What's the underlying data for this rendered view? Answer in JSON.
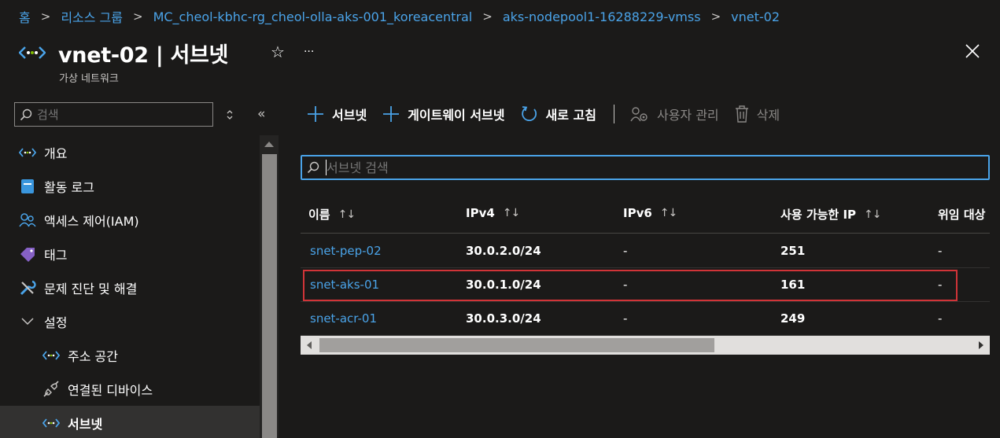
{
  "breadcrumb": [
    {
      "label": "홈"
    },
    {
      "label": "리소스 그룹"
    },
    {
      "label": "MC_cheol-kbhc-rg_cheol-olla-aks-001_koreacentral"
    },
    {
      "label": "aks-nodepool1-16288229-vmss"
    },
    {
      "label": "vnet-02"
    }
  ],
  "header": {
    "title": "vnet-02 | 서브넷",
    "subtitle": "가상 네트워크",
    "favorite_glyph": "☆",
    "more_glyph": "···"
  },
  "sidebar": {
    "search_placeholder": "검색",
    "collapse_glyph": "«",
    "items": [
      {
        "label": "개요",
        "icon": "vnet-icon"
      },
      {
        "label": "활동 로그",
        "icon": "activity-log-icon"
      },
      {
        "label": "액세스 제어(IAM)",
        "icon": "people-icon"
      },
      {
        "label": "태그",
        "icon": "tag-icon"
      },
      {
        "label": "문제 진단 및 해결",
        "icon": "wrench-icon"
      },
      {
        "label": "설정",
        "icon": "chevron-down-icon"
      },
      {
        "label": "주소 공간",
        "icon": "vnet-icon"
      },
      {
        "label": "연결된 디바이스",
        "icon": "plug-icon"
      },
      {
        "label": "서브넷",
        "icon": "vnet-icon"
      }
    ]
  },
  "toolbar": {
    "add_subnet": "서브넷",
    "add_gateway_subnet": "게이트웨이 서브넷",
    "refresh": "새로 고침",
    "manage_users": "사용자 관리",
    "delete": "삭제"
  },
  "main": {
    "search_placeholder": "서브넷 검색"
  },
  "table": {
    "sort_glyph": "↑↓",
    "columns": [
      "이름",
      "IPv4",
      "IPv6",
      "사용 가능한 IP",
      "위임 대상"
    ],
    "rows": [
      {
        "name": "snet-pep-02",
        "ipv4": "30.0.2.0/24",
        "ipv6": "-",
        "available_ip": "251",
        "delegated": "-"
      },
      {
        "name": "snet-aks-01",
        "ipv4": "30.0.1.0/24",
        "ipv6": "-",
        "available_ip": "161",
        "delegated": "-"
      },
      {
        "name": "snet-acr-01",
        "ipv4": "30.0.3.0/24",
        "ipv6": "-",
        "available_ip": "249",
        "delegated": "-"
      }
    ]
  },
  "colors": {
    "accent": "#4aa3e8",
    "highlight_border": "#d13438",
    "background": "#1b1a19"
  }
}
